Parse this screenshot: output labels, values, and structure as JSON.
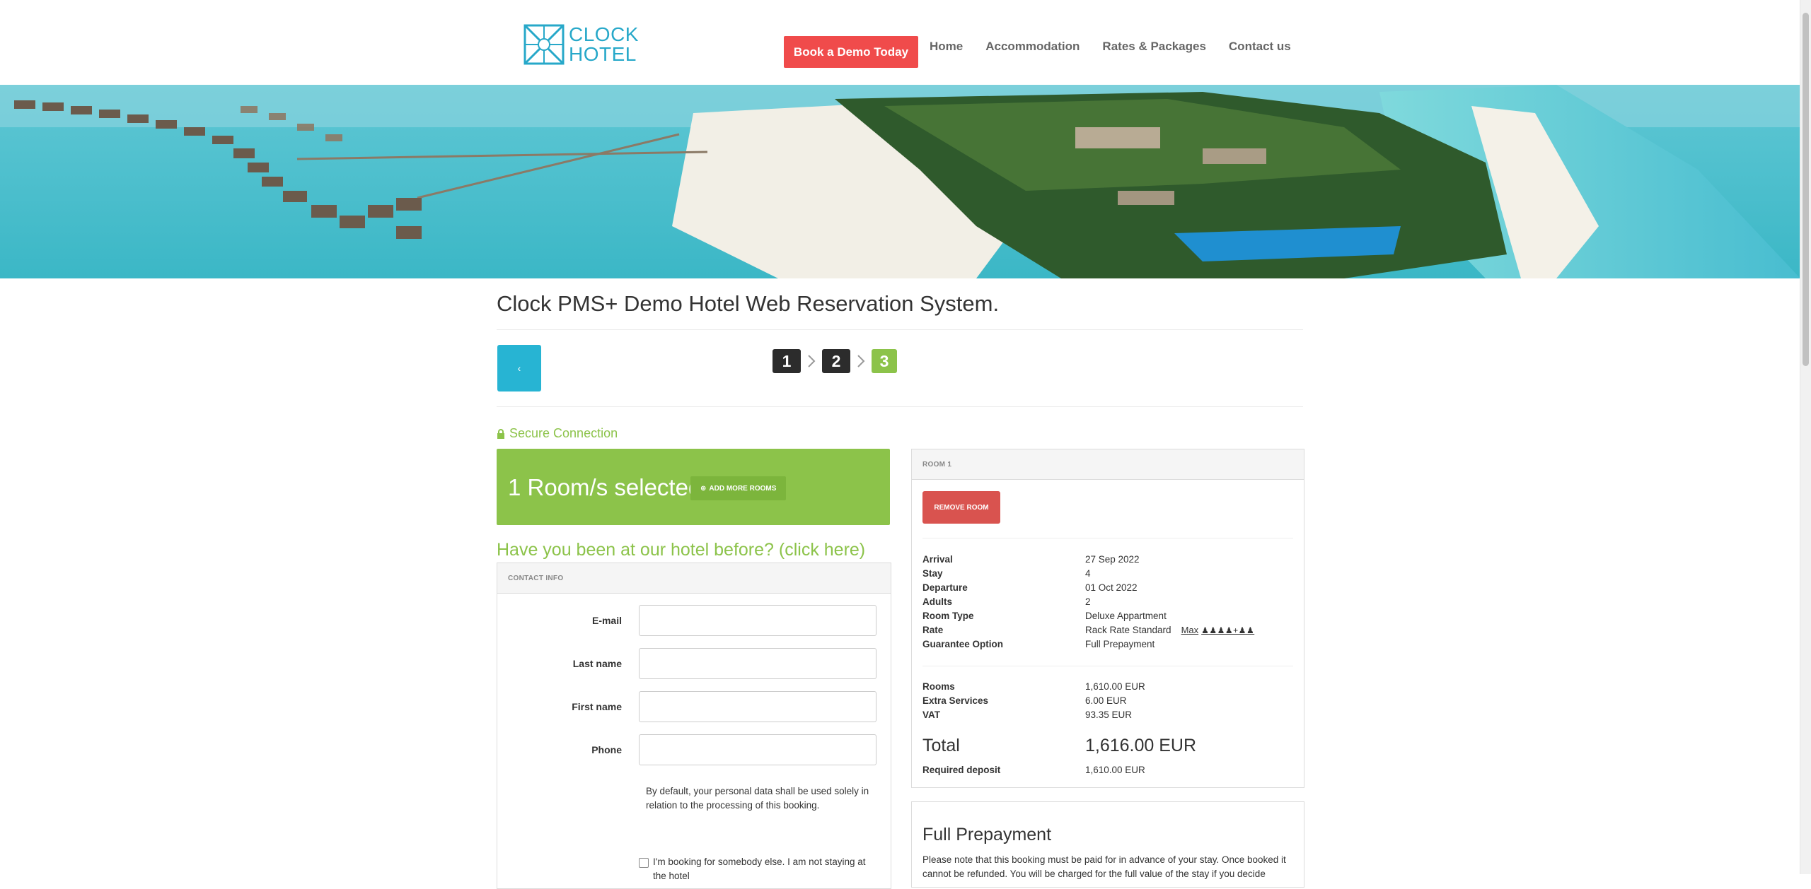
{
  "header": {
    "logo_line1": "CLOCK",
    "logo_line2": "HOTEL",
    "demo_button": "Book a Demo Today",
    "nav": [
      "Home",
      "Accommodation",
      "Rates & Packages",
      "Contact us"
    ]
  },
  "page": {
    "title": "Clock PMS+ Demo Hotel Web Reservation System.",
    "back_icon": "chevron-left-icon",
    "steps": [
      "1",
      "2",
      "3"
    ],
    "active_step": "3"
  },
  "secure": {
    "label": "Secure Connection",
    "icon": "lock-icon"
  },
  "rooms_selected": {
    "text": "1 Room/s selected",
    "add_button": "ADD MORE ROOMS"
  },
  "returning_link": "Have you been at our hotel before? (click here)",
  "contact": {
    "header": "CONTACT INFO",
    "fields": [
      {
        "label": "E-mail",
        "value": ""
      },
      {
        "label": "Last name",
        "value": ""
      },
      {
        "label": "First name",
        "value": ""
      },
      {
        "label": "Phone",
        "value": ""
      }
    ],
    "privacy": "By default, your personal data shall be used solely in relation to the processing of this booking.",
    "checkbox_label": "I'm booking for somebody else. I am not staying at the hotel"
  },
  "room": {
    "header": "ROOM 1",
    "remove_button": "REMOVE ROOM",
    "details": [
      {
        "label": "Arrival",
        "value": "27 Sep 2022"
      },
      {
        "label": "Stay",
        "value": "4"
      },
      {
        "label": "Departure",
        "value": "01 Oct 2022"
      },
      {
        "label": "Adults",
        "value": "2"
      },
      {
        "label": "Room Type",
        "value": "Deluxe Appartment"
      },
      {
        "label": "Rate",
        "value": "Rack Rate Standard"
      },
      {
        "label": "Guarantee Option",
        "value": "Full Prepayment"
      }
    ],
    "rate_max": "Max",
    "rate_persons": "♟♟♟♟+♟♟",
    "costs": [
      {
        "label": "Rooms",
        "value": "1,610.00 EUR"
      },
      {
        "label": "Extra Services",
        "value": "6.00 EUR"
      },
      {
        "label": "VAT",
        "value": "93.35 EUR"
      }
    ],
    "total_label": "Total",
    "total_value": "1,616.00 EUR",
    "deposit_label": "Required deposit",
    "deposit_value": "1,610.00 EUR"
  },
  "prepayment": {
    "title": "Full Prepayment",
    "text": "Please note that this booking must be paid for in advance of your stay. Once booked it cannot be refunded. You will be charged for the full value of the stay if you decide"
  }
}
